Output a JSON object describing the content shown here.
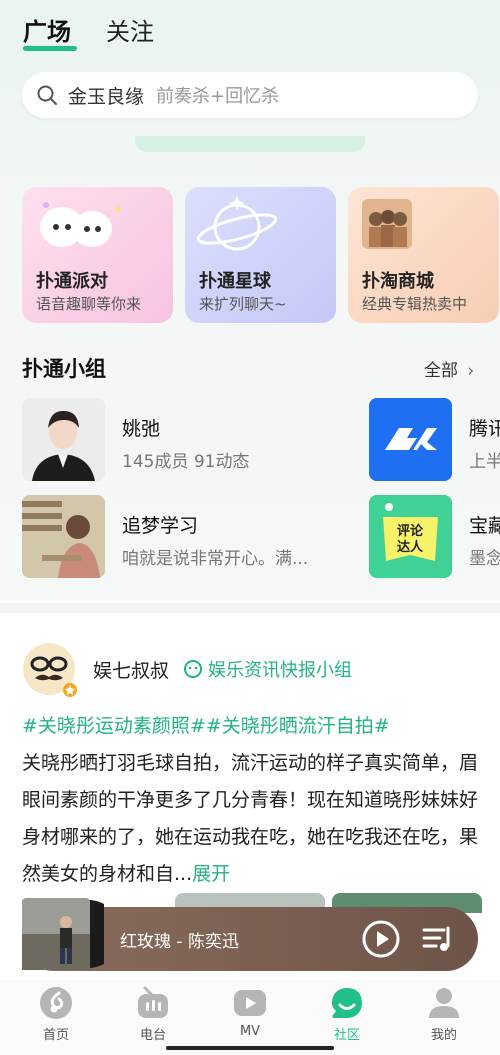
{
  "tabs": [
    {
      "label": "广场",
      "active": true
    },
    {
      "label": "关注",
      "active": false
    }
  ],
  "search": {
    "query": "金玉良缘",
    "hint": "前奏杀+回忆杀"
  },
  "feature_cards": [
    {
      "title": "扑通派对",
      "subtitle": "语音趣聊等你来",
      "color": "#fbd4e8"
    },
    {
      "title": "扑通星球",
      "subtitle": "来扩列聊天~",
      "color": "#cfd3fb"
    },
    {
      "title": "扑淘商城",
      "subtitle": "经典专辑热卖中",
      "color": "#fbdcc9"
    }
  ],
  "groups_section": {
    "title": "扑通小组",
    "more_label": "全部"
  },
  "groups": [
    {
      "name": "姚弛",
      "stat": "145成员 91动态"
    },
    {
      "name": "腾讯",
      "stat": "上半"
    },
    {
      "name": "追梦学习",
      "stat": "咱就是说非常开心。满..."
    },
    {
      "name": "宝藏",
      "stat": "墨念"
    }
  ],
  "group_badge_text": "评论达人",
  "post": {
    "author": "娱七叔叔",
    "group": "娱乐资讯快报小组",
    "tags": "#关晓彤运动素颜照##关晓彤晒流汗自拍#",
    "body": "关晓彤晒打羽毛球自拍，流汗运动的样子真实简单，眉眼间素颜的干净更多了几分青春！现在知道晓彤妹妹好身材哪来的了，她在运动我在吃，她在吃我还在吃，果然美女的身材和自...",
    "expand_label": "展开"
  },
  "player": {
    "song": "红玫瑰 - 陈奕迅"
  },
  "nav": [
    {
      "label": "首页",
      "icon": "home-icon",
      "active": false
    },
    {
      "label": "电台",
      "icon": "radio-icon",
      "active": false
    },
    {
      "label": "MV",
      "icon": "mv-icon",
      "active": false
    },
    {
      "label": "社区",
      "icon": "community-icon",
      "active": true
    },
    {
      "label": "我的",
      "icon": "profile-icon",
      "active": false
    }
  ],
  "colors": {
    "accent": "#21c08b",
    "nav_inactive": "#b5b5b5"
  }
}
